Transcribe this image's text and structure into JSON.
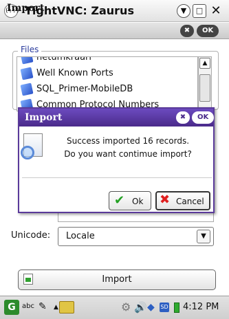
{
  "window": {
    "icon_text": "(::)",
    "title": "TightVNC: Zaurus"
  },
  "header": {
    "title": "Import",
    "close_label": "✖",
    "ok_label": "OK"
  },
  "files": {
    "label": "Files",
    "items": [
      {
        "name": "netumkraari"
      },
      {
        "name": "Well Known Ports"
      },
      {
        "name": "SQL_Primer-MobileDB"
      },
      {
        "name": "Common Protocol Numbers"
      }
    ]
  },
  "unicode": {
    "label": "Unicode:",
    "value": "Locale"
  },
  "import_button": {
    "label": "Import"
  },
  "dialog": {
    "title": "Import",
    "close_label": "✖",
    "ok_label": "OK",
    "message_line1": "Success imported 16 records.",
    "message_line2": "Do you want contimue import?",
    "ok_button": "Ok",
    "cancel_button": "Cancel"
  },
  "taskbar": {
    "app_letter": "G",
    "input_mode": "abc",
    "time": "4:12 PM",
    "sd_label": "SD"
  },
  "colors": {
    "dialog_accent": "#5a3a9a",
    "files_label": "#2a3b9c",
    "ok_check": "#22a022",
    "cancel_x": "#e02020"
  }
}
